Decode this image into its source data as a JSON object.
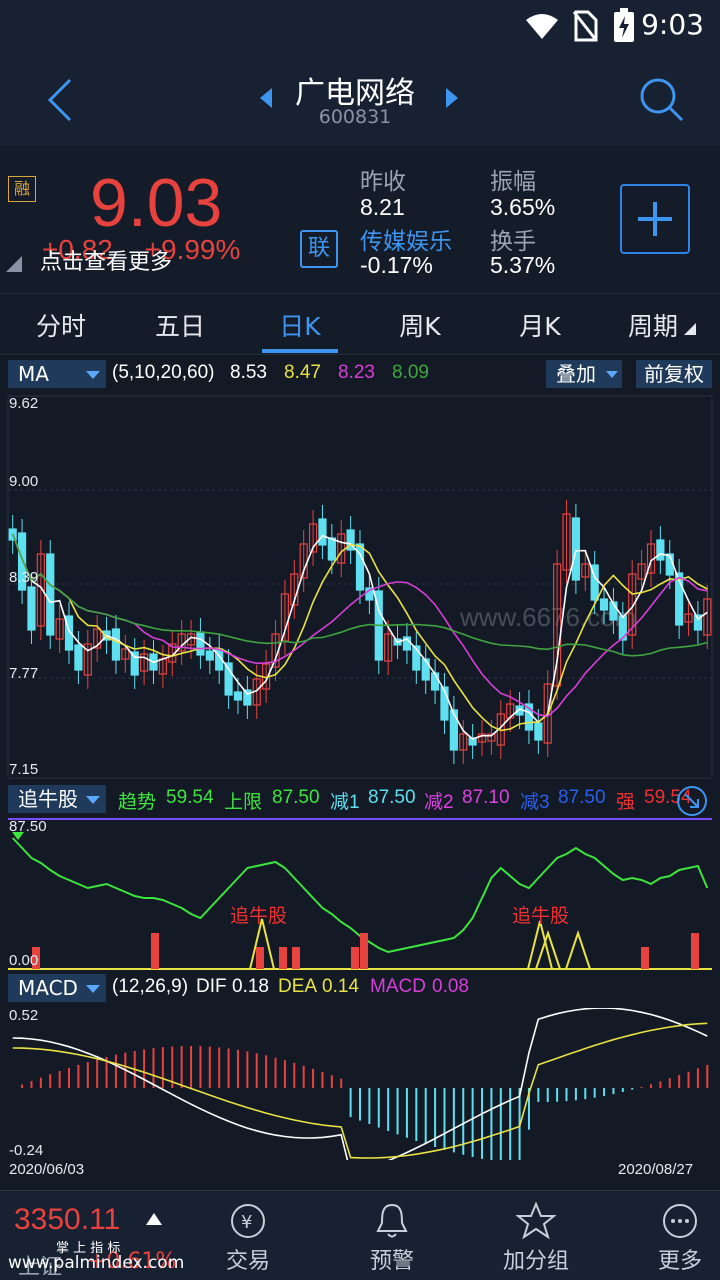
{
  "status_bar": {
    "time": "9:03"
  },
  "header": {
    "stock_name": "广电网络",
    "stock_code": "600831"
  },
  "quote": {
    "margin_badge": "融",
    "price": "9.03",
    "change": "+0.82",
    "change_pct": "+9.99%",
    "hint": "点击查看更多",
    "link_badge": "联",
    "prev_close_label": "昨收",
    "prev_close": "8.21",
    "sector_label": "传媒娱乐",
    "sector_change": "-0.17%",
    "amplitude_label": "振幅",
    "amplitude": "3.65%",
    "turnover_label": "换手",
    "turnover": "5.37%",
    "plus": "+"
  },
  "tabs": [
    "分时",
    "五日",
    "日K",
    "周K",
    "月K",
    "周期"
  ],
  "active_tab": "日K",
  "ma_bar": {
    "selector": "MA",
    "params": "(5,10,20,60)",
    "v1": "8.53",
    "v2": "8.47",
    "v3": "8.23",
    "v4": "8.09",
    "overlay": "叠加",
    "adjust": "前复权"
  },
  "price_axis": {
    "top": "9.62",
    "l2": "9.00",
    "l3": "8.39",
    "l4": "7.77",
    "bottom": "7.15"
  },
  "watermark": "www.6676.com",
  "bull_bar": {
    "selector": "追牛股",
    "trend_label": "趋势",
    "trend": "59.54",
    "upper_label": "上限",
    "upper": "87.50",
    "j1_label": "减1",
    "j1": "87.50",
    "j2_label": "减2",
    "j2": "87.10",
    "j3_label": "减3",
    "j3": "87.50",
    "strong_label": "强",
    "strong": "59.54"
  },
  "bull_axis": {
    "top": "87.50",
    "bottom": "0.00"
  },
  "bull_markers": [
    "追牛股",
    "追牛股"
  ],
  "macd_bar": {
    "selector": "MACD",
    "params": "(12,26,9)",
    "dif_label": "DIF",
    "dif": "0.18",
    "dea_label": "DEA",
    "dea": "0.14",
    "macd_label": "MACD",
    "macd": "0.08"
  },
  "macd_axis": {
    "top": "0.52",
    "bottom": "-0.24"
  },
  "dates": {
    "start": "2020/06/03",
    "end": "2020/08/27"
  },
  "bottom_nav": {
    "index_value": "3350.11",
    "index_name": "上证",
    "index_pct": "+0.61%",
    "watermark_small": "掌 上 指 标",
    "watermark_url": "www.palmindex.com",
    "items": [
      "交易",
      "预警",
      "加分组",
      "更多"
    ]
  },
  "colors": {
    "up": "#e8423f",
    "down": "#5ee0f0",
    "ma5": "#ffffff",
    "ma10": "#e9e243",
    "ma20": "#d63fd6",
    "ma60": "#3fa43f",
    "accent": "#3e95f0"
  }
}
